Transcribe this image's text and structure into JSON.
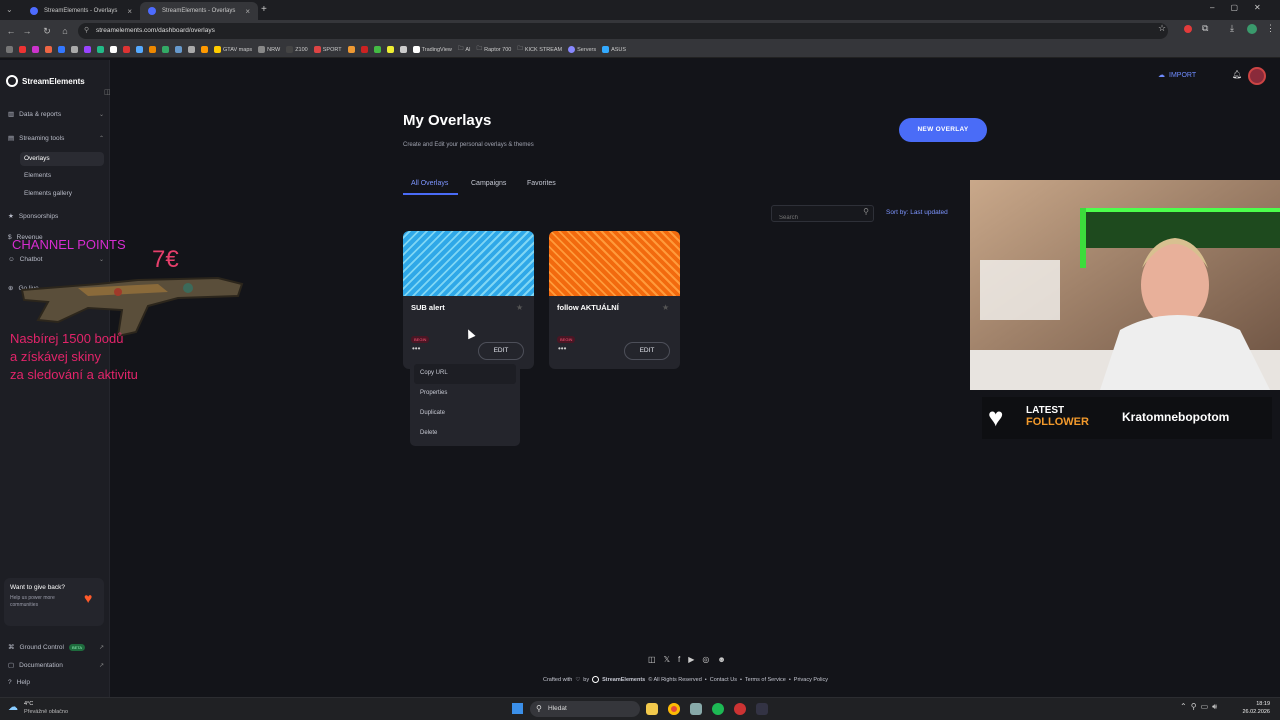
{
  "browser": {
    "tabs": [
      {
        "title": "StreamElements - Overlays",
        "active": false
      },
      {
        "title": "StreamElements - Overlays",
        "active": true
      }
    ],
    "url": "streamelements.com/dashboard/overlays",
    "bookmarks": [
      "GTAV maps",
      "NRW",
      "Z100",
      "SPORT",
      "TradingView",
      "AI",
      "Raptor 700",
      "KICK STREAM",
      "Servers",
      "ASUS"
    ]
  },
  "sidebar": {
    "brand": "StreamElements",
    "items": [
      {
        "label": "Data & reports",
        "has_caret": true
      },
      {
        "label": "Streaming tools",
        "has_caret": true
      },
      {
        "label": "Overlays",
        "selected": true
      },
      {
        "label": "Elements"
      },
      {
        "label": "Elements gallery"
      },
      {
        "label": "Sponsorships"
      },
      {
        "label": "Revenue"
      },
      {
        "label": "Chatbot",
        "has_caret": true
      },
      {
        "label": "Go live"
      }
    ],
    "give_back": {
      "title": "Want to give back?",
      "text": "Help us power more communities"
    },
    "footer": [
      {
        "label": "Ground Control",
        "badge": "BETA"
      },
      {
        "label": "Documentation"
      },
      {
        "label": "Help"
      }
    ]
  },
  "header": {
    "import_label": "IMPORT"
  },
  "page": {
    "title": "My Overlays",
    "subtitle": "Create and Edit your personal overlays & themes",
    "new_overlay": "NEW OVERLAY",
    "tabs": [
      "All Overlays",
      "Campaigns",
      "Favorites"
    ],
    "search_placeholder": "Search",
    "sort_label": "Sort by: Last updated"
  },
  "overlays": [
    {
      "name": "SUB alert",
      "badge": "BEGIN",
      "edit": "EDIT",
      "colors": [
        "#2fa8e8",
        "#7fd6f4"
      ]
    },
    {
      "name": "follow AKTUÁLNÍ",
      "badge": "BEGIN",
      "edit": "EDIT",
      "colors": [
        "#f26a0e",
        "#ff9a3a"
      ]
    }
  ],
  "context_menu": [
    "Copy URL",
    "Properties",
    "Duplicate",
    "Delete"
  ],
  "footer": {
    "crafted": "Crafted with",
    "by": "by",
    "brand": "StreamElements",
    "rights": "© All Rights Reserved",
    "links": [
      "Contact Us",
      "Terms of Service",
      "Privacy Policy"
    ]
  },
  "stream_overlay": {
    "channel_points": "CHANNEL POINTS",
    "price": "7€",
    "promo_lines": [
      "Nasbírej 1500 bodů",
      "a získávej skiny",
      "za sledování a aktivitu"
    ],
    "latest_label_1": "LATEST",
    "latest_label_2": "FOLLOWER",
    "follower_name": "Kratomnebopotom"
  },
  "taskbar": {
    "weather_temp": "4°C",
    "weather_desc": "Převážně oblačno",
    "search": "Hledat",
    "time": "18:19",
    "date": "26.02.2026"
  },
  "colors": {
    "accent": "#4a6cf7",
    "badge": "#ff5577",
    "follower_orange": "#f39a2c"
  }
}
